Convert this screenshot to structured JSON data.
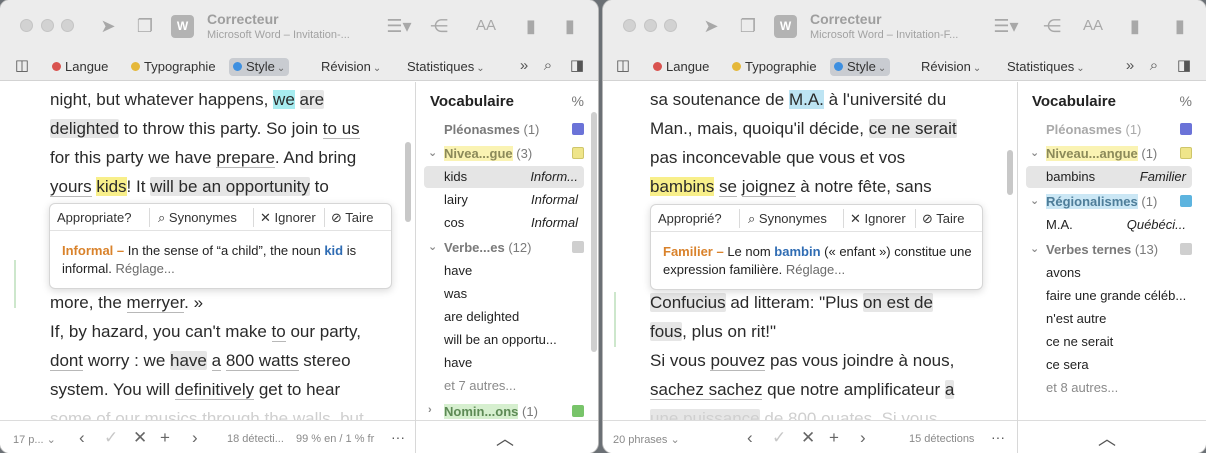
{
  "left": {
    "app_title": "Correcteur",
    "doc_subtitle": "Microsoft Word – Invitation-...",
    "font_size_label": "AA",
    "tabs": {
      "langue": "Langue",
      "typographie": "Typographie",
      "style": "Style",
      "revision": "Révision",
      "statistiques": "Statistiques"
    },
    "lines": [
      [
        "night, but whatever happens, ",
        "we",
        " ",
        "are"
      ],
      [
        "delighted",
        " to throw this party. So join ",
        "to us"
      ],
      [
        "for this party we have ",
        "prepare",
        ". And bring"
      ],
      [
        "yours",
        " ",
        "kids",
        "! It ",
        "will be an opportunity",
        " to"
      ],
      [
        "more, the ",
        "merryer",
        ". »"
      ],
      [
        "If, by hazard, you can't make ",
        "to",
        " our party,"
      ],
      [
        "dont",
        " worry : we ",
        "have",
        " ",
        "a",
        " ",
        "800 watts",
        " stereo"
      ],
      [
        "system. You will ",
        "definitively",
        " get to hear"
      ],
      [
        "some of our musics through the walls, but"
      ]
    ],
    "popup": {
      "appropriate": "Appropriate?",
      "synonyms": "Synonymes",
      "ignore": "Ignorer",
      "silence": "Taire",
      "type": "Informal –",
      "text_before": " In the sense of “a child”, the noun ",
      "keyword": "kid",
      "text_after": " is informal. ",
      "settings_link": "Réglage..."
    },
    "status": {
      "count": "17 p...",
      "detections": "18 détecti...",
      "lang_pct": "99 % en / 1 % fr",
      "more": "···"
    },
    "sidebar": {
      "title": "Vocabulaire",
      "pct": "%",
      "pleonasmes": {
        "label": "Pléonasmes",
        "count": "(1)"
      },
      "niveau": {
        "label": "Nivea...gue",
        "count": "(3)"
      },
      "niveau_items": [
        {
          "label": "kids",
          "value": "Inform..."
        },
        {
          "label": "lairy",
          "value": "Informal"
        },
        {
          "label": "cos",
          "value": "Informal"
        }
      ],
      "verbes": {
        "label": "Verbe...es",
        "count": "(12)"
      },
      "verbes_items": [
        "have",
        "was",
        "are delighted",
        "will be an opportu...",
        "have"
      ],
      "verbes_more": "et 7 autres...",
      "nominal": {
        "label": "Nomin...ons",
        "count": "(1)"
      }
    }
  },
  "right": {
    "app_title": "Correcteur",
    "doc_subtitle": "Microsoft Word – Invitation-F...",
    "font_size_label": "AA",
    "tabs": {
      "langue": "Langue",
      "typographie": "Typographie",
      "style": "Style",
      "revision": "Révision",
      "statistiques": "Statistiques"
    },
    "lines": [
      [
        "sa soutenance de ",
        "M.A.",
        " à l'université du"
      ],
      [
        "Man., mais, quoiqu'il décide, ",
        "ce ne serait"
      ],
      [
        "pas inconcevable que vous et vos"
      ],
      [
        "bambins",
        " ",
        "se",
        " ",
        "joignez",
        " à notre fête, sans"
      ],
      [
        "Confucius",
        " ad litteram: \"Plus ",
        "on est de"
      ],
      [
        "fous",
        ", plus on rit!\""
      ],
      [
        "Si vous ",
        "pouvez",
        " pas vous joindre à nous,"
      ],
      [
        "sachez sachez",
        " que notre amplificateur ",
        "a"
      ],
      [
        "une puissance",
        " de 800 ouates. Si vous"
      ]
    ],
    "popup": {
      "appropriate": "Approprié?",
      "synonyms": "Synonymes",
      "ignore": "Ignorer",
      "silence": "Taire",
      "type": "Familier –",
      "text_before": " Le nom ",
      "keyword": "bambin",
      "text_after": " (« enfant ») constitue une expression familière. ",
      "settings_link": "Réglage..."
    },
    "status": {
      "count": "20 phrases",
      "detections": "15 détections",
      "more": "···"
    },
    "sidebar": {
      "title": "Vocabulaire",
      "pct": "%",
      "pleonasmes": {
        "label": "Pléonasmes",
        "count": "(1)"
      },
      "niveau": {
        "label": "Niveau...angue",
        "count": "(1)"
      },
      "niveau_items": [
        {
          "label": "bambins",
          "value": "Familier"
        }
      ],
      "regionalismes": {
        "label": "Régionalismes",
        "count": "(1)"
      },
      "regionalismes_items": [
        {
          "label": "M.A.",
          "value": "Québéci..."
        }
      ],
      "verbes": {
        "label": "Verbes ternes",
        "count": "(13)"
      },
      "verbes_items": [
        "avons",
        "faire une grande céléb...",
        "n'est autre",
        "ce ne serait",
        "ce sera"
      ],
      "verbes_more": "et 8 autres..."
    }
  },
  "colors": {
    "langue_dot": "#d9534f",
    "typographie_dot": "#e5b83a",
    "style_dot": "#3d8fe0",
    "pleonasmes_box": "#6b73d8",
    "niveau_box": "#efe58a",
    "regionalismes_box": "#5db4df",
    "verbes_box": "#cfcfcf",
    "nominal_box": "#78c46a"
  }
}
